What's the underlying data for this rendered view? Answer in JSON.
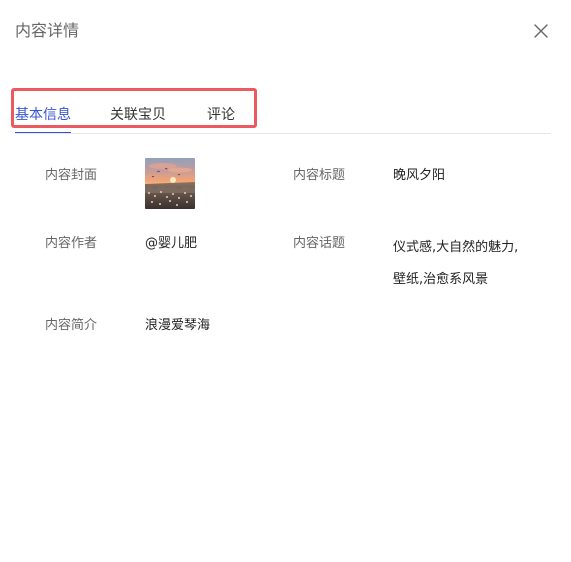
{
  "dialog": {
    "title": "内容详情"
  },
  "tabs": [
    {
      "label": "基本信息",
      "active": true
    },
    {
      "label": "关联宝贝",
      "active": false
    },
    {
      "label": "评论",
      "active": false
    }
  ],
  "content_info": {
    "cover_label": "内容封面",
    "cover_image": "sunset-cityscape-thumbnail",
    "title_label": "内容标题",
    "title_value": "晚风夕阳",
    "author_label": "内容作者",
    "author_value": "@婴儿肥",
    "topic_label": "内容话题",
    "topic_value": "仪式感,大自然的魅力,壁纸,治愈系风景",
    "intro_label": "内容简介",
    "intro_value": "浪漫爱琴海"
  },
  "colors": {
    "accent": "#3553d4",
    "highlight_box": "#ea5a5e",
    "label_text": "#666666",
    "value_text": "#222222"
  },
  "icons": {
    "close": "close-icon"
  }
}
